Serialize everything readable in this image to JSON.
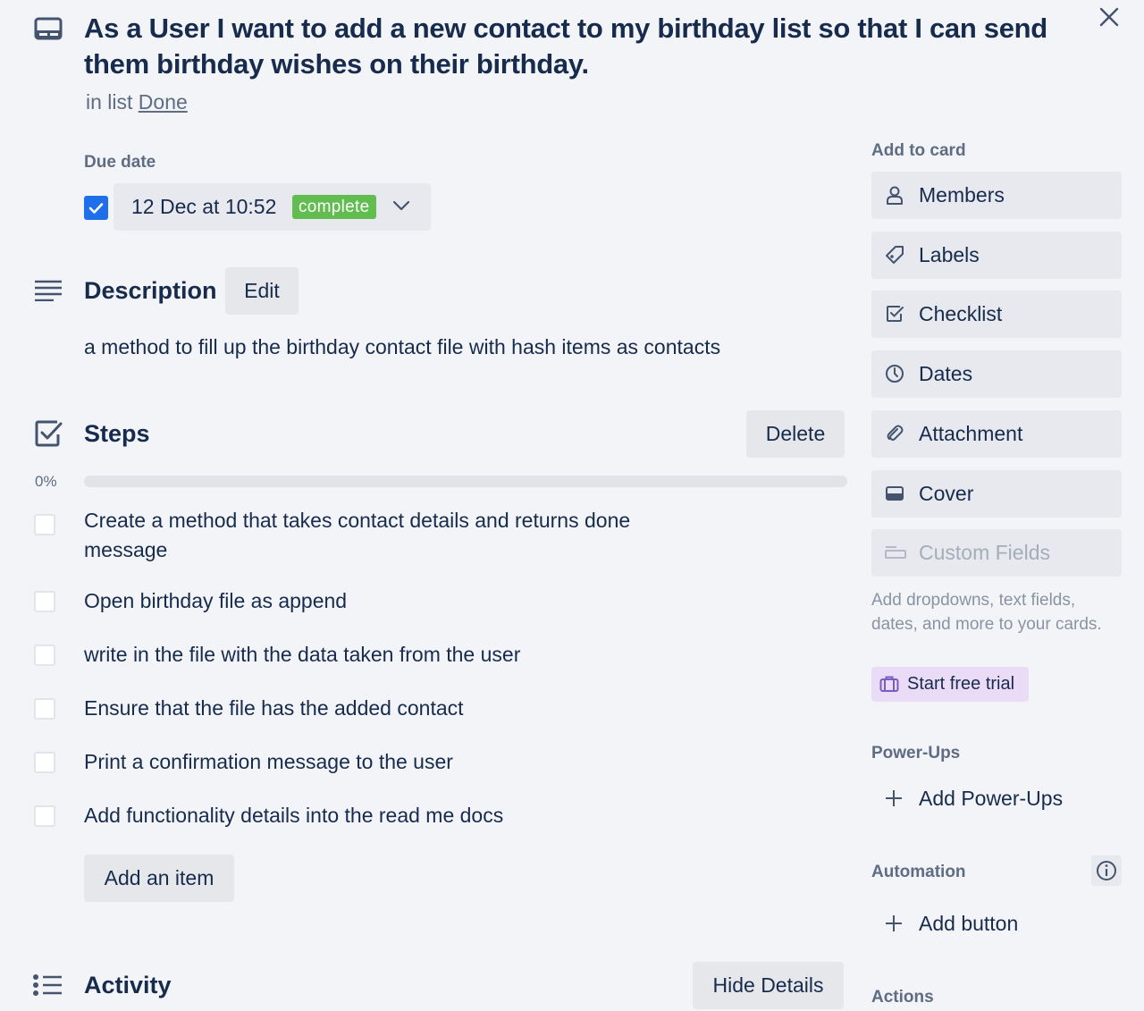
{
  "card": {
    "title": "As a User I want to add a new contact to my birthday list so that I can send them birthday wishes on their birthday.",
    "in_list_prefix": "in list",
    "list_name": "Done"
  },
  "due_date": {
    "label": "Due date",
    "checked": true,
    "value": "12 Dec at 10:52",
    "status": "complete"
  },
  "description": {
    "heading": "Description",
    "edit_label": "Edit",
    "text": "a method to fill up the birthday contact file with hash items as contacts"
  },
  "checklist": {
    "title": "Steps",
    "delete_label": "Delete",
    "progress": "0%",
    "progress_value": 0,
    "items": [
      {
        "text": "Create a method that takes contact details and returns done message",
        "checked": false
      },
      {
        "text": "Open birthday file as append",
        "checked": false
      },
      {
        "text": "write in the file with the data taken from the user",
        "checked": false
      },
      {
        "text": "Ensure that the file has the added contact",
        "checked": false
      },
      {
        "text": "Print a confirmation message to the user",
        "checked": false
      },
      {
        "text": "Add functionality details into the read me docs",
        "checked": false
      }
    ],
    "add_item_label": "Add an item"
  },
  "activity": {
    "heading": "Activity",
    "hide_details_label": "Hide Details"
  },
  "sidebar": {
    "add_to_card_label": "Add to card",
    "buttons": [
      {
        "label": "Members",
        "icon": "person-icon"
      },
      {
        "label": "Labels",
        "icon": "tag-icon"
      },
      {
        "label": "Checklist",
        "icon": "checklist-icon"
      },
      {
        "label": "Dates",
        "icon": "clock-icon"
      },
      {
        "label": "Attachment",
        "icon": "paperclip-icon"
      },
      {
        "label": "Cover",
        "icon": "cover-icon"
      },
      {
        "label": "Custom Fields",
        "icon": "custom-fields-icon",
        "disabled": true
      }
    ],
    "custom_fields_upsell": "Add dropdowns, text fields, dates, and more to your cards.",
    "start_trial_label": "Start free trial",
    "power_ups_label": "Power-Ups",
    "add_power_ups_label": "Add Power-Ups",
    "automation_label": "Automation",
    "add_button_label": "Add button",
    "actions_label": "Actions"
  },
  "colors": {
    "text": "#172b4d",
    "muted": "#5e6c84",
    "accent_blue": "#1f6feb",
    "complete_green": "#61bd4f",
    "trial_purple": "#eadcf7"
  }
}
